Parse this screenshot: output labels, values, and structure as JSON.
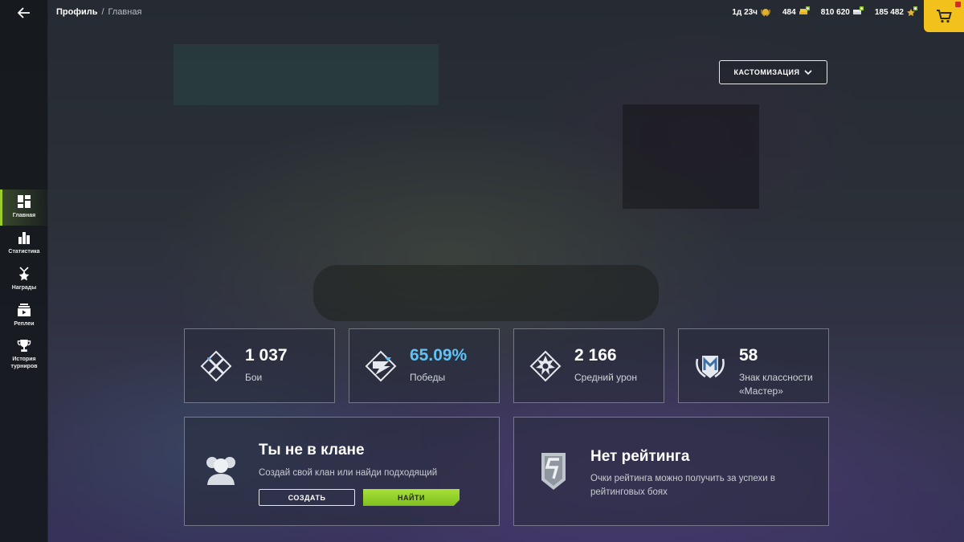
{
  "header": {
    "breadcrumb": {
      "main": "Профиль",
      "separator": "/",
      "current": "Главная"
    },
    "currencies": [
      {
        "value": "1д 23ч",
        "icon": "premium-laurel-icon"
      },
      {
        "value": "484",
        "icon": "gold-icon"
      },
      {
        "value": "810 620",
        "icon": "credits-icon"
      },
      {
        "value": "185 482",
        "icon": "free-xp-icon"
      }
    ],
    "cart_icon": "cart-icon"
  },
  "sidebar": {
    "back_icon": "back-arrow-icon",
    "items": [
      {
        "label": "Главная",
        "icon": "grid-icon",
        "active": true
      },
      {
        "label": "Статистика",
        "icon": "bar-chart-icon",
        "active": false
      },
      {
        "label": "Награды",
        "icon": "star-medal-icon",
        "active": false
      },
      {
        "label": "Реплеи",
        "icon": "replay-icon",
        "active": false
      },
      {
        "label": "История турниров",
        "icon": "trophy-icon",
        "active": false
      }
    ]
  },
  "customize_button": {
    "label": "КАСТОМИЗАЦИЯ"
  },
  "stats": [
    {
      "value": "1 037",
      "label": "Бои",
      "icon": "battles-icon"
    },
    {
      "value": "65.09%",
      "label": "Победы",
      "icon": "victories-icon"
    },
    {
      "value": "2 166",
      "label": "Средний урон",
      "icon": "damage-icon"
    },
    {
      "value": "58",
      "label": "Знак классности «Мастер»",
      "icon": "mastery-badge-icon"
    }
  ],
  "clan": {
    "title": "Ты не в клане",
    "description": "Создай свой клан или найди подходящий",
    "create_label": "СОЗДАТЬ",
    "find_label": "НАЙТИ",
    "icon": "clan-group-icon"
  },
  "rating": {
    "title": "Нет рейтинга",
    "description": "Очки рейтинга можно получить за успехи в рейтинговых боях",
    "icon": "rating-shield-icon"
  },
  "colors": {
    "accent_green": "#9ccc2b",
    "win_rate_blue": "#5fc3f5",
    "cart_yellow": "#f2c11c"
  }
}
